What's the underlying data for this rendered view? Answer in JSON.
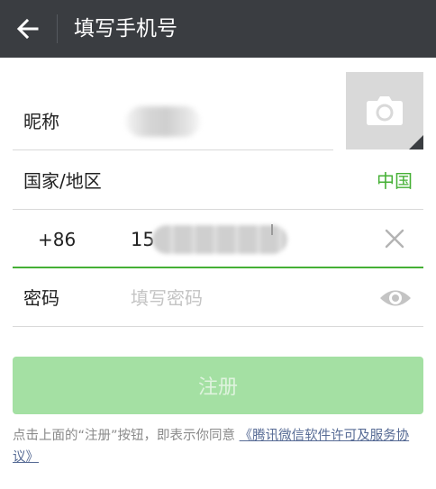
{
  "header": {
    "title": "填写手机号",
    "back_icon": "arrow-left-icon"
  },
  "form": {
    "nickname": {
      "label": "昵称",
      "value": ""
    },
    "avatar": {
      "icon": "camera-icon"
    },
    "country": {
      "label": "国家/地区",
      "value": "中国"
    },
    "phone": {
      "country_code": "+86",
      "visible_prefix": "15",
      "clear_icon": "close-icon"
    },
    "password": {
      "label": "密码",
      "placeholder": "填写密码",
      "visibility_icon": "eye-icon"
    }
  },
  "register_button": {
    "label": "注册"
  },
  "agreement": {
    "text": "点击上面的“注册”按钮，即表示你同意",
    "link_text": "《腾讯微信软件许可及服务协议》"
  },
  "colors": {
    "header_bg": "#3a3d41",
    "accent": "#45b035",
    "button_disabled": "#a4e0a3",
    "link": "#576b95"
  }
}
